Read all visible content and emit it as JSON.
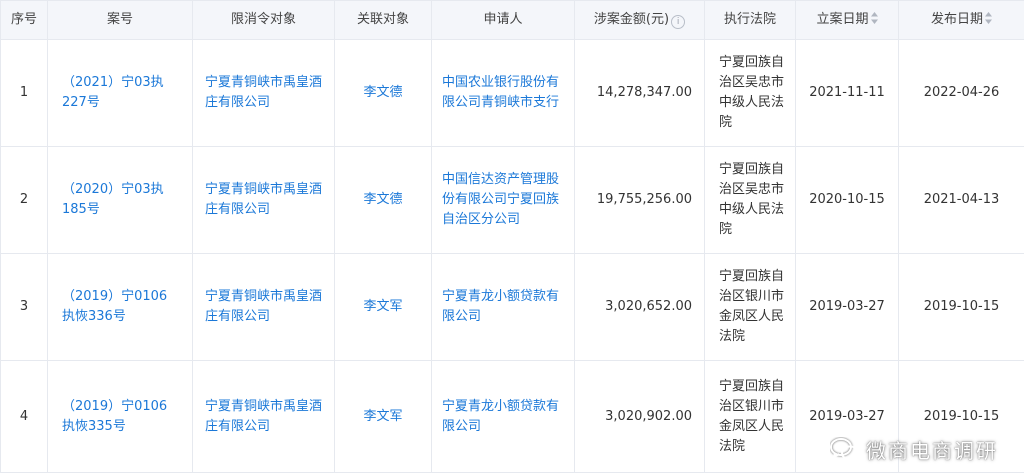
{
  "colors": {
    "link": "#1b78d8",
    "header_bg": "#f4f6fa",
    "border": "#e6e9ef"
  },
  "headers": {
    "seq": "序号",
    "case_no": "案号",
    "target": "限消令对象",
    "related": "关联对象",
    "applicant": "申请人",
    "amount": "涉案金额(元)",
    "court": "执行法院",
    "filed_date": "立案日期",
    "publish_date": "发布日期"
  },
  "rows": [
    {
      "seq": "1",
      "case_no": "（2021）宁03执227号",
      "target": "宁夏青铜峡市禹皇酒庄有限公司",
      "related": "李文德",
      "applicant": "中国农业银行股份有限公司青铜峡市支行",
      "amount": "14,278,347.00",
      "court": "宁夏回族自治区吴忠市中级人民法院",
      "filed_date": "2021-11-11",
      "publish_date": "2022-04-26"
    },
    {
      "seq": "2",
      "case_no": "（2020）宁03执185号",
      "target": "宁夏青铜峡市禹皇酒庄有限公司",
      "related": "李文德",
      "applicant": "中国信达资产管理股份有限公司宁夏回族自治区分公司",
      "amount": "19,755,256.00",
      "court": "宁夏回族自治区吴忠市中级人民法院",
      "filed_date": "2020-10-15",
      "publish_date": "2021-04-13"
    },
    {
      "seq": "3",
      "case_no": "（2019）宁0106执恢336号",
      "target": "宁夏青铜峡市禹皇酒庄有限公司",
      "related": "李文军",
      "applicant": "宁夏青龙小额贷款有限公司",
      "amount": "3,020,652.00",
      "court": "宁夏回族自治区银川市金凤区人民法院",
      "filed_date": "2019-03-27",
      "publish_date": "2019-10-15"
    },
    {
      "seq": "4",
      "case_no": "（2019）宁0106执恢335号",
      "target": "宁夏青铜峡市禹皇酒庄有限公司",
      "related": "李文军",
      "applicant": "宁夏青龙小额贷款有限公司",
      "amount": "3,020,902.00",
      "court": "宁夏回族自治区银川市金凤区人民法院",
      "filed_date": "2019-03-27",
      "publish_date": "2019-10-15"
    }
  ],
  "watermark": {
    "text": "微商电商调研",
    "icon": "wechat-logo-icon"
  }
}
